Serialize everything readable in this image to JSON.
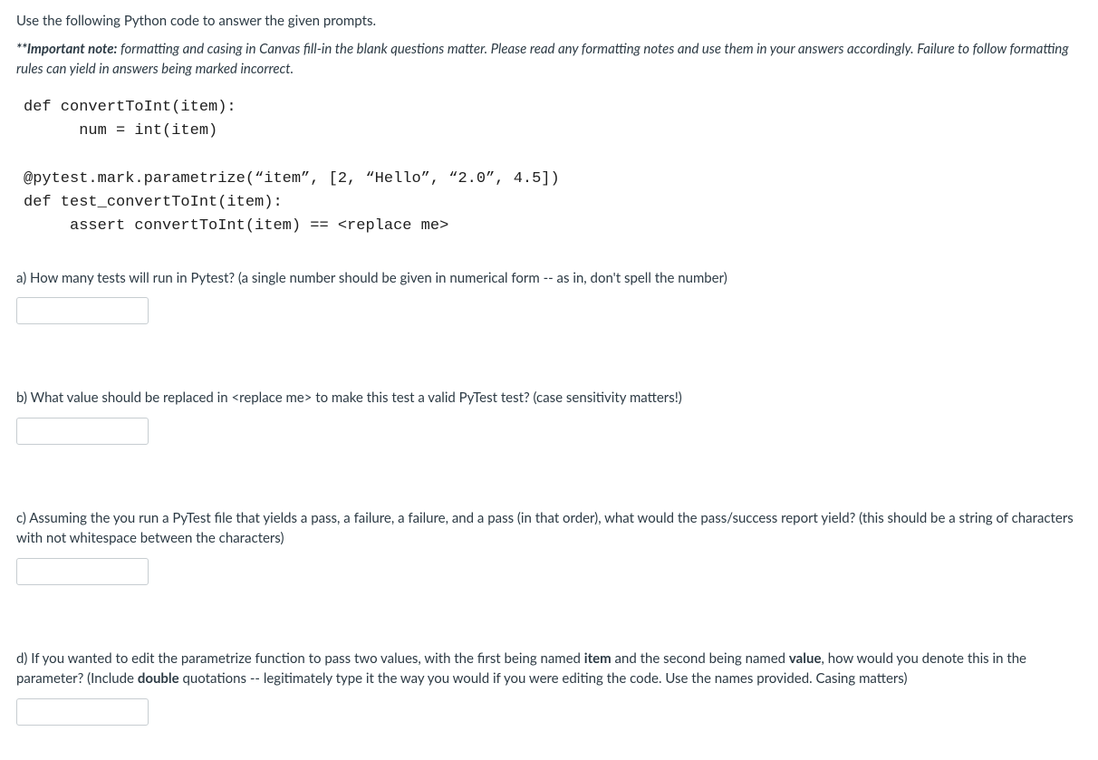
{
  "intro": "Use the following Python code to answer the given prompts.",
  "note_strong": "**Important note:",
  "note_rest": " formatting and casing in Canvas fill-in the blank questions matter. Please read any formatting notes and use them in your answers accordingly. Failure to follow formatting rules can yield in answers being marked incorrect.",
  "code": "def convertToInt(item):\n      num = int(item)\n\n@pytest.mark.parametrize(“item”, [2, “Hello”, “2.0”, 4.5])\ndef test_convertToInt(item):\n     assert convertToInt(item) == <replace me>",
  "questions": {
    "a": {
      "text": "a) How many tests will run in Pytest? (a single number should be given in numerical form -- as in, don't spell the number)",
      "value": ""
    },
    "b": {
      "text": "b) What value should be replaced in <replace me> to make this test a valid PyTest test? (case sensitivity matters!)",
      "value": ""
    },
    "c": {
      "text": "c) Assuming the you run a PyTest file that yields a pass, a failure, a failure, and a pass (in that order), what would the pass/success report yield? (this should be a string of characters with not whitespace between the characters)",
      "value": ""
    },
    "d": {
      "prefix": "d) If you wanted to edit the parametrize function to pass two values, with the first being named ",
      "b1": "item",
      "mid1": " and the second being named ",
      "b2": "value",
      "mid2": ", how would you denote this in the parameter? (Include ",
      "b3": "double",
      "suffix": " quotations -- legitimately type it the way you would if you were editing the code. Use the names provided. Casing matters)",
      "value": ""
    }
  }
}
